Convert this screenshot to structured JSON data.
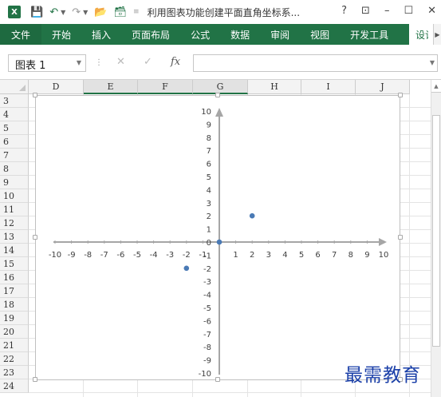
{
  "app": {
    "logo_text": "X",
    "title": "利用图表功能创建平面直角坐标系...",
    "help": "?",
    "restore_ribbon": "⊡",
    "minimize": "–",
    "maximize": "☐",
    "close": "✕"
  },
  "ribbon": {
    "tabs": [
      "文件",
      "开始",
      "插入",
      "页面布局",
      "公式",
      "数据",
      "审阅",
      "视图",
      "开发工具",
      "设计"
    ]
  },
  "formula_bar": {
    "name_box": "图表 1",
    "cancel": "✕",
    "enter": "✓",
    "fx": "fx",
    "value": ""
  },
  "sheet": {
    "columns": [
      "D",
      "E",
      "F",
      "G",
      "H",
      "I",
      "J"
    ],
    "rows": [
      "3",
      "4",
      "5",
      "6",
      "7",
      "8",
      "9",
      "10",
      "11",
      "12",
      "13",
      "14",
      "15",
      "16",
      "17",
      "18",
      "19",
      "20",
      "21",
      "22",
      "23",
      "24"
    ]
  },
  "chart_data": {
    "type": "scatter",
    "title": "",
    "xlabel": "",
    "ylabel": "",
    "xlim": [
      -10,
      10
    ],
    "ylim": [
      -10,
      10
    ],
    "x_ticks": [
      -10,
      -9,
      -8,
      -7,
      -6,
      -5,
      -4,
      -3,
      -2,
      -1,
      0,
      1,
      2,
      3,
      4,
      5,
      6,
      7,
      8,
      9,
      10
    ],
    "y_ticks": [
      10,
      9,
      8,
      7,
      6,
      5,
      4,
      3,
      2,
      1,
      0,
      -1,
      -2,
      -3,
      -4,
      -5,
      -6,
      -7,
      -8,
      -9,
      -10
    ],
    "points": [
      [
        2,
        2
      ],
      [
        -2,
        -2
      ],
      [
        0,
        0
      ]
    ],
    "marker_color": "#4a7ab5",
    "axis_color": "#a6a6a6",
    "grid": false,
    "legend": "none"
  },
  "watermark": "最需教育"
}
